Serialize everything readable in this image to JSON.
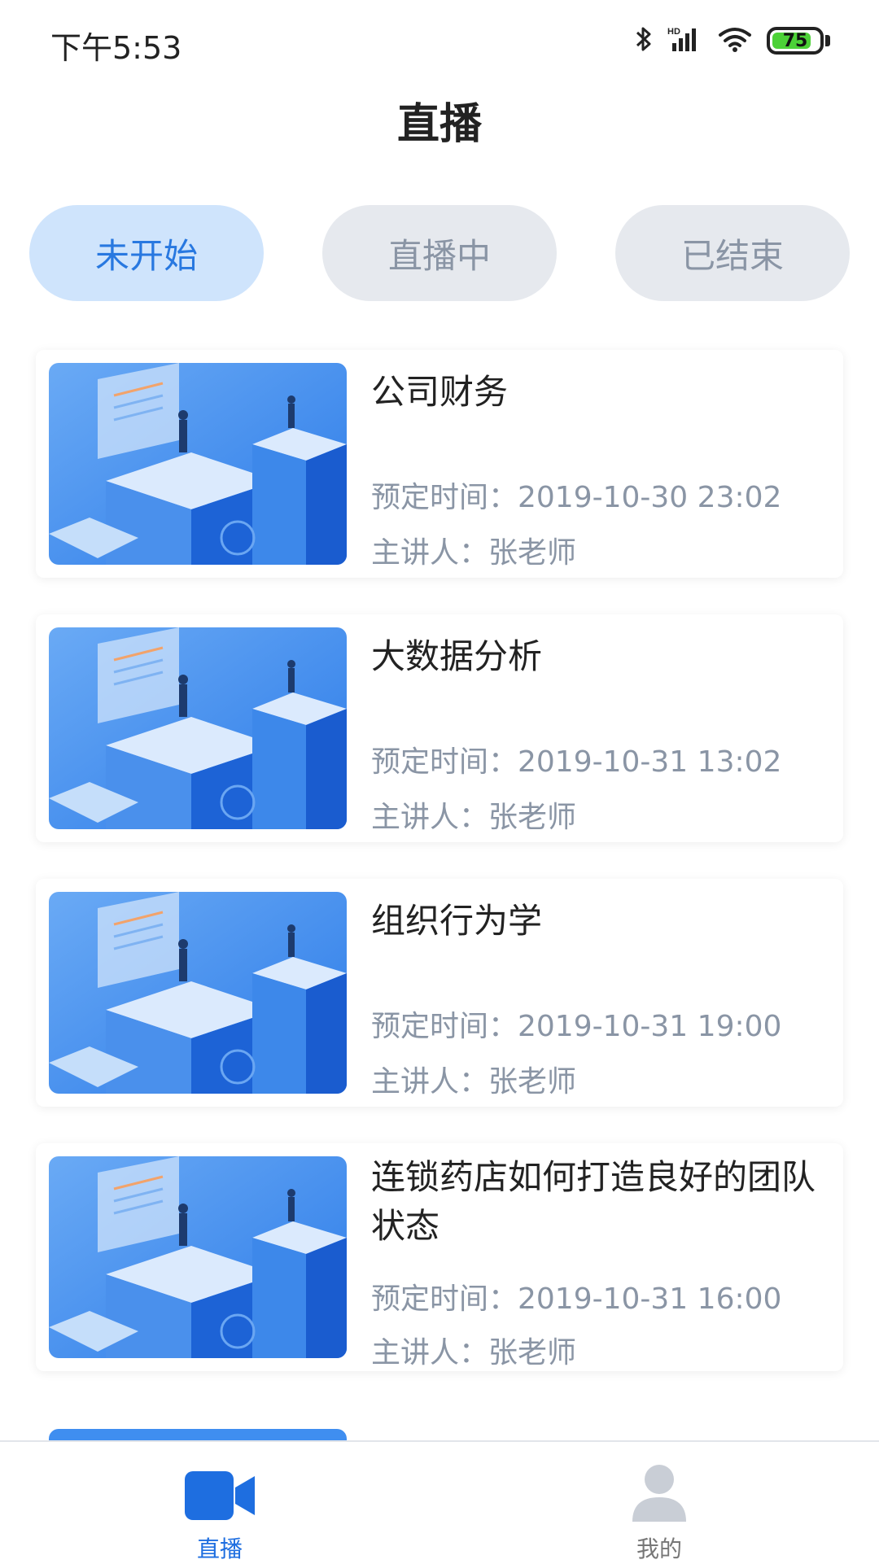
{
  "status_bar": {
    "time": "下午5:53",
    "battery": "75",
    "icons": [
      "bluetooth-icon",
      "hd-signal-icon",
      "wifi-icon",
      "battery-icon"
    ]
  },
  "header": {
    "title": "直播"
  },
  "tabs": [
    {
      "label": "未开始",
      "active": true
    },
    {
      "label": "直播中",
      "active": false
    },
    {
      "label": "已结束",
      "active": false
    }
  ],
  "courses": [
    {
      "title": "公司财务",
      "time": "预定时间：2019-10-30 23:02",
      "host": "主讲人：张老师"
    },
    {
      "title": "大数据分析",
      "time": "预定时间：2019-10-31 13:02",
      "host": "主讲人：张老师"
    },
    {
      "title": "组织行为学",
      "time": "预定时间：2019-10-31 19:00",
      "host": "主讲人：张老师"
    },
    {
      "title": "连锁药店如何打造良好的团队状态",
      "time": "预定时间：2019-10-31 16:00",
      "host": "主讲人：张老师"
    }
  ],
  "bottom_nav": [
    {
      "label": "直播",
      "icon": "video-camera-icon",
      "active": true
    },
    {
      "label": "我的",
      "icon": "user-icon",
      "active": false
    }
  ],
  "colors": {
    "accent": "#1e6ee0",
    "active_tab_bg": "#cfe4fc",
    "inactive_tab_bg": "#e6e9ee",
    "muted_text": "#8a95a5"
  }
}
